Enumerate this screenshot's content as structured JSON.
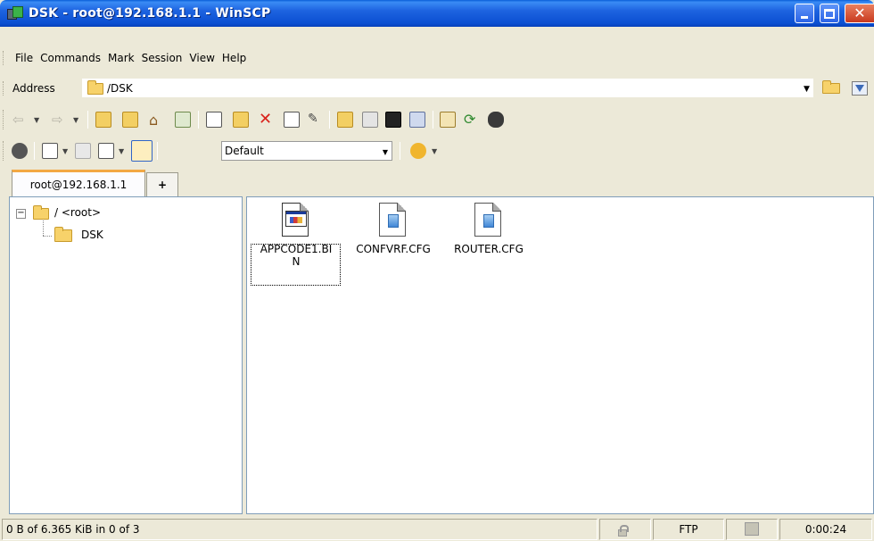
{
  "window": {
    "title": "DSK - root@192.168.1.1 - WinSCP",
    "icon": "winscp-icon"
  },
  "menu": {
    "items": [
      "File",
      "Commands",
      "Mark",
      "Session",
      "View",
      "Help"
    ]
  },
  "address": {
    "label": "Address",
    "value": "/DSK"
  },
  "toolbar": {
    "profile_value": "Default",
    "icons": [
      "back-icon",
      "forward-icon",
      "parent-dir-icon",
      "root-dir-icon",
      "home-icon",
      "refresh-icon",
      "edit-icon",
      "open-icon",
      "delete-icon",
      "properties-icon",
      "rename-icon",
      "new-folder-icon",
      "calculate-icon",
      "terminal-icon",
      "console-icon",
      "compare-icon",
      "synchronize-icon",
      "find-icon",
      "preferences-icon",
      "view-icon",
      "sort-icon",
      "columns-icon",
      "tree-icon",
      "transfer-settings-icon"
    ]
  },
  "tabs": {
    "active": "root@192.168.1.1",
    "add": "+"
  },
  "tree": {
    "root": "/ <root>",
    "child": "DSK"
  },
  "files": [
    {
      "name_line1": "APPCODE1.BI",
      "name_line2": "N",
      "icon": "executable-file-icon"
    },
    {
      "name_line1": "CONFVRF.CFG",
      "name_line2": "",
      "icon": "config-file-icon"
    },
    {
      "name_line1": "ROUTER.CFG",
      "name_line2": "",
      "icon": "config-file-icon"
    }
  ],
  "status": {
    "selection": "0 B of 6.365 KiB in 0 of 3",
    "protocol": "FTP",
    "elapsed": "0:00:24"
  },
  "colors": {
    "title_bar": "#0b4fd1",
    "panel_border": "#7f9db9",
    "window_bg": "#ece9d8",
    "tab_accent": "#f3a843"
  }
}
